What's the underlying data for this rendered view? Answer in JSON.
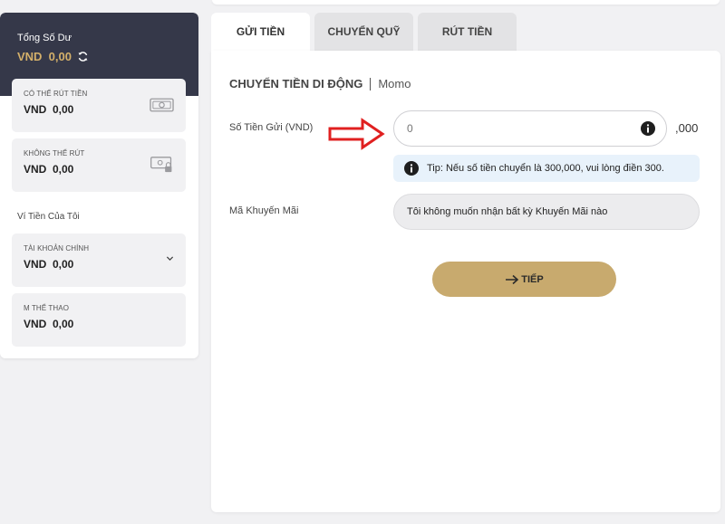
{
  "sidebar": {
    "total": {
      "label": "Tổng Số Dư",
      "amount": "VND  0,00",
      "icon": "refresh-icon"
    },
    "withdrawable": {
      "label": "CÓ THỂ RÚT TIỀN",
      "amount": "VND  0,00",
      "icon": "cash-icon"
    },
    "non_withdrawable": {
      "label": "KHÔNG THỂ RÚT",
      "amount": "VND  0,00",
      "icon": "locked-cash-icon"
    },
    "wallets_title": "Ví Tiền Của Tôi",
    "main_account": {
      "label": "TÀI KHOẢN CHÍNH",
      "amount": "VND  0,00",
      "icon": "chevron-down-icon"
    },
    "sports": {
      "label": "M THỂ THAO",
      "amount": "VND  0,00"
    }
  },
  "tabs": [
    {
      "label": "GỬI TIỀN",
      "active": true
    },
    {
      "label": "CHUYỂN QUỸ",
      "active": false
    },
    {
      "label": "RÚT TIỀN",
      "active": false
    }
  ],
  "deposit": {
    "title": "CHUYỂN TIỀN DI ĐỘNG",
    "method": "Momo",
    "amount_label": "Số Tiền Gửi (VND)",
    "amount_placeholder": "0",
    "amount_suffix": ",000",
    "tip": "Tip: Nếu số tiền chuyển là 300,000, vui lòng điền 300.",
    "promo_label": "Mã Khuyến Mãi",
    "promo_value": "Tôi không muốn nhận bất kỳ Khuyến Mãi nào",
    "next_label": "TIẾP"
  },
  "colors": {
    "accent_gold": "#c8aa6e",
    "sidebar_dark": "#353849",
    "amount_gold": "#d4b06a",
    "annotation_red": "#e02020",
    "tip_bg": "#e8f2fb"
  }
}
